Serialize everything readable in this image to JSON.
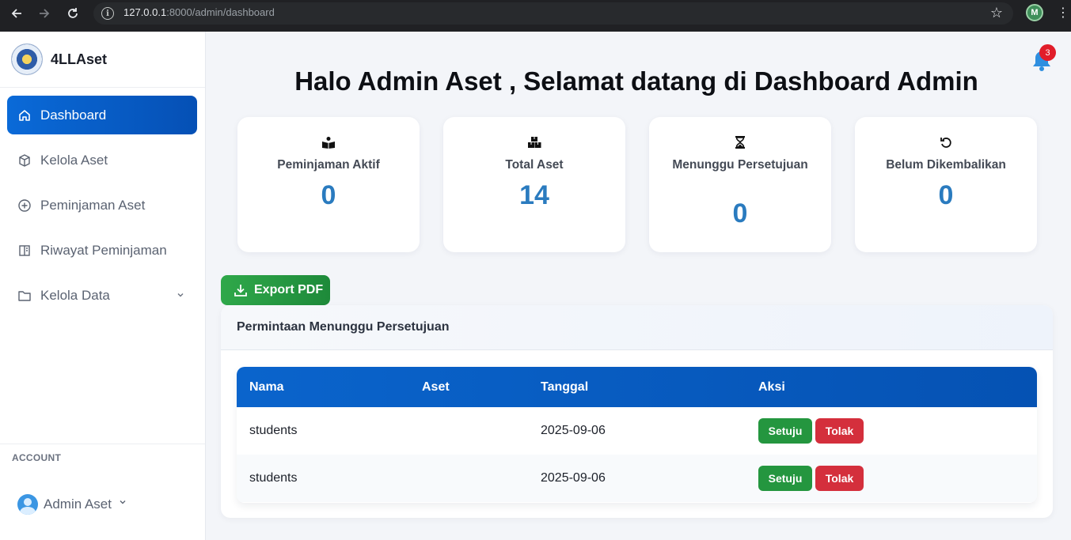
{
  "browser": {
    "url_host": "127.0.0.1",
    "url_path": ":8000/admin/dashboard",
    "profile_initial": "M"
  },
  "sidebar": {
    "brand": "4LLAset",
    "items": [
      {
        "label": "Dashboard",
        "icon": "home-icon",
        "active": true
      },
      {
        "label": "Kelola Aset",
        "icon": "box-icon"
      },
      {
        "label": "Peminjaman Aset",
        "icon": "plus-circle-icon"
      },
      {
        "label": "Riwayat Peminjaman",
        "icon": "book-icon"
      },
      {
        "label": "Kelola Data",
        "icon": "folder-icon",
        "has_submenu": true
      }
    ],
    "account_label": "ACCOUNT",
    "account_name": "Admin Aset"
  },
  "header": {
    "notification_count": "3",
    "welcome": "Halo Admin Aset , Selamat datang di Dashboard Admin"
  },
  "stats": [
    {
      "label": "Peminjaman Aktif",
      "value": "0",
      "icon": "book-reader-icon"
    },
    {
      "label": "Total Aset",
      "value": "14",
      "icon": "boxes-icon"
    },
    {
      "label": "Menunggu Persetujuan",
      "value": "0",
      "icon": "hourglass-icon"
    },
    {
      "label": "Belum Dikembalikan",
      "value": "0",
      "icon": "undo-icon"
    }
  ],
  "export_label": "Export PDF",
  "panel": {
    "title": "Permintaan Menunggu Persetujuan",
    "columns": [
      "Nama",
      "Aset",
      "Tanggal",
      "Aksi"
    ],
    "rows": [
      {
        "nama": "students",
        "aset": "",
        "tanggal": "2025-09-06",
        "approve": "Setuju",
        "reject": "Tolak"
      },
      {
        "nama": "students",
        "aset": "",
        "tanggal": "2025-09-06",
        "approve": "Setuju",
        "reject": "Tolak"
      }
    ]
  },
  "colors": {
    "primary": "#0a6ad8",
    "stat_value": "#2a7bbf",
    "success": "#24963f",
    "danger": "#d42f3c",
    "badge": "#e11d2a"
  }
}
